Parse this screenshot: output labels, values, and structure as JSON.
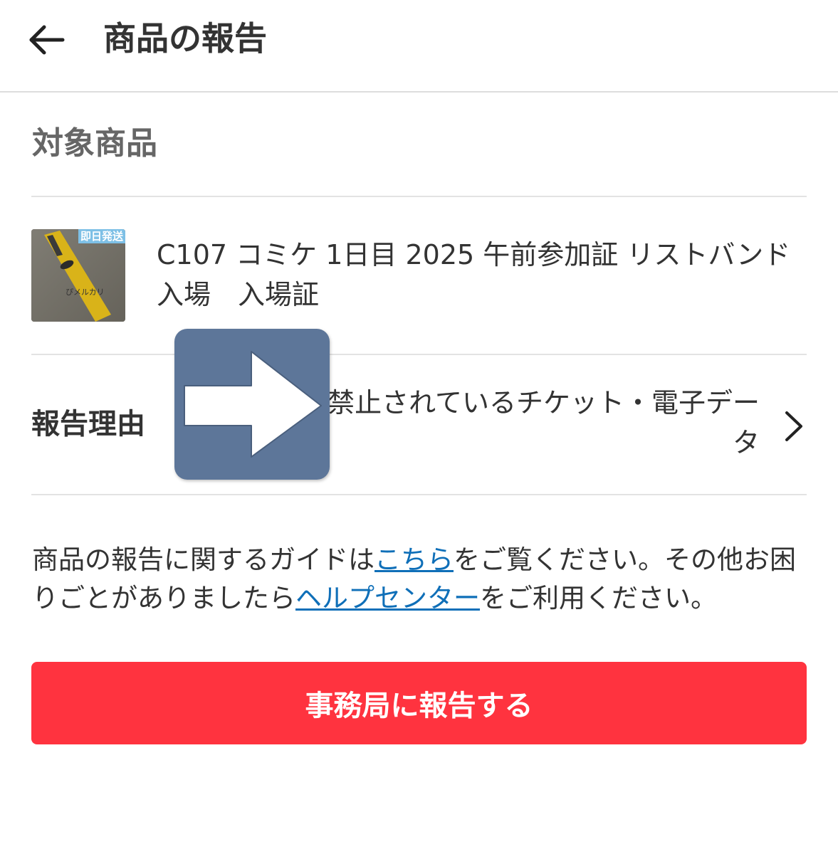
{
  "header": {
    "back_icon": "arrow-left-icon",
    "title": "商品の報告"
  },
  "section": {
    "title": "対象商品"
  },
  "item": {
    "badge": "即日発送",
    "thumbnail_text": "ぴメルカリ",
    "title": "C107 コミケ 1日目 2025 午前参加証 リストバンド 入場　入場証"
  },
  "reason": {
    "label": "報告理由",
    "value": "禁止されているチケット・電子データ",
    "chevron_icon": "chevron-right-icon"
  },
  "overlay": {
    "icon": "arrow-right-icon",
    "color": "#5d7699"
  },
  "guide": {
    "text_1": "商品の報告に関するガイドは",
    "link_1": "こちら",
    "text_2": "をご覧ください。その他お困りごとがありましたら",
    "link_2": "ヘルプセンター",
    "text_3": "をご利用ください。"
  },
  "submit": {
    "label": "事務局に報告する",
    "color": "#ff333f"
  },
  "colors": {
    "link": "#0f6fb8",
    "divider": "#e3e3e3"
  }
}
